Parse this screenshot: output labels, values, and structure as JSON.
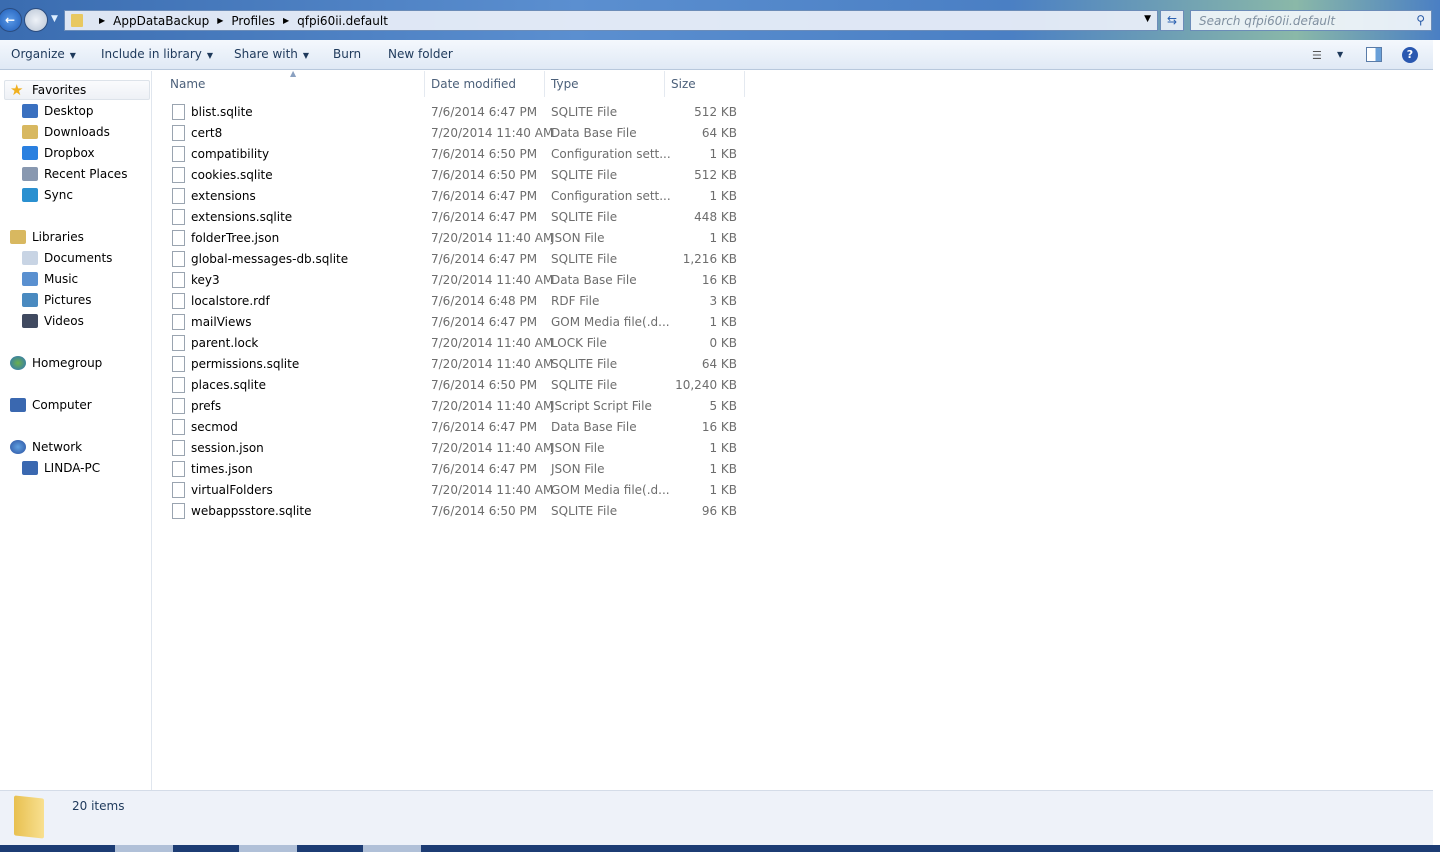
{
  "nav": {
    "breadcrumb": [
      "AppDataBackup",
      "Profiles",
      "qfpi60ii.default"
    ],
    "search_placeholder": "Search qfpi60ii.default"
  },
  "toolbar": {
    "organize": "Organize",
    "include": "Include in library",
    "share": "Share with",
    "burn": "Burn",
    "new_folder": "New folder"
  },
  "sidebar": {
    "favorites": "Favorites",
    "fav_items": [
      "Desktop",
      "Downloads",
      "Dropbox",
      "Recent Places",
      "Sync"
    ],
    "libraries": "Libraries",
    "lib_items": [
      "Documents",
      "Music",
      "Pictures",
      "Videos"
    ],
    "homegroup": "Homegroup",
    "computer": "Computer",
    "network": "Network",
    "net_items": [
      "LINDA-PC"
    ]
  },
  "columns": {
    "name": "Name",
    "date": "Date modified",
    "type": "Type",
    "size": "Size"
  },
  "files": [
    [
      "blist.sqlite",
      "7/6/2014 6:47 PM",
      "SQLITE File",
      "512 KB"
    ],
    [
      "cert8",
      "7/20/2014 11:40 AM",
      "Data Base File",
      "64 KB"
    ],
    [
      "compatibility",
      "7/6/2014 6:50 PM",
      "Configuration sett...",
      "1 KB"
    ],
    [
      "cookies.sqlite",
      "7/6/2014 6:50 PM",
      "SQLITE File",
      "512 KB"
    ],
    [
      "extensions",
      "7/6/2014 6:47 PM",
      "Configuration sett...",
      "1 KB"
    ],
    [
      "extensions.sqlite",
      "7/6/2014 6:47 PM",
      "SQLITE File",
      "448 KB"
    ],
    [
      "folderTree.json",
      "7/20/2014 11:40 AM",
      "JSON File",
      "1 KB"
    ],
    [
      "global-messages-db.sqlite",
      "7/6/2014 6:47 PM",
      "SQLITE File",
      "1,216 KB"
    ],
    [
      "key3",
      "7/20/2014 11:40 AM",
      "Data Base File",
      "16 KB"
    ],
    [
      "localstore.rdf",
      "7/6/2014 6:48 PM",
      "RDF File",
      "3 KB"
    ],
    [
      "mailViews",
      "7/6/2014 6:47 PM",
      "GOM Media file(.d...",
      "1 KB"
    ],
    [
      "parent.lock",
      "7/20/2014 11:40 AM",
      "LOCK File",
      "0 KB"
    ],
    [
      "permissions.sqlite",
      "7/20/2014 11:40 AM",
      "SQLITE File",
      "64 KB"
    ],
    [
      "places.sqlite",
      "7/6/2014 6:50 PM",
      "SQLITE File",
      "10,240 KB"
    ],
    [
      "prefs",
      "7/20/2014 11:40 AM",
      "JScript Script File",
      "5 KB"
    ],
    [
      "secmod",
      "7/6/2014 6:47 PM",
      "Data Base File",
      "16 KB"
    ],
    [
      "session.json",
      "7/20/2014 11:40 AM",
      "JSON File",
      "1 KB"
    ],
    [
      "times.json",
      "7/6/2014 6:47 PM",
      "JSON File",
      "1 KB"
    ],
    [
      "virtualFolders",
      "7/20/2014 11:40 AM",
      "GOM Media file(.d...",
      "1 KB"
    ],
    [
      "webappsstore.sqlite",
      "7/6/2014 6:50 PM",
      "SQLITE File",
      "96 KB"
    ]
  ],
  "status": {
    "count": "20 items"
  }
}
